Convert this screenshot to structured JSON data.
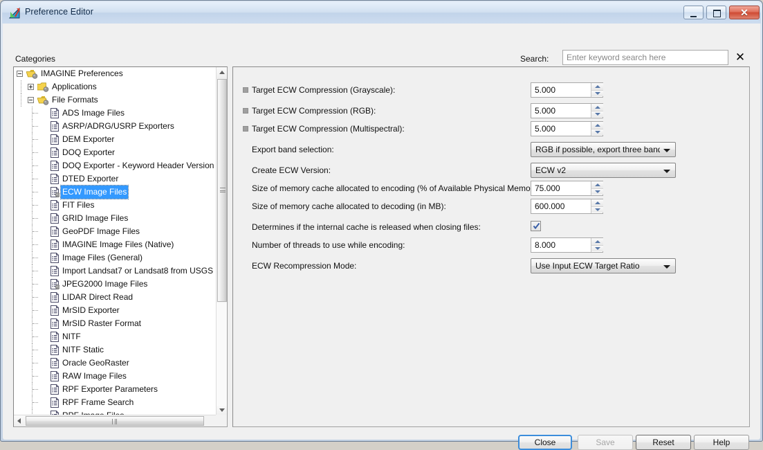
{
  "window": {
    "title": "Preference Editor",
    "icon": "imagine-app-icon",
    "controls": {
      "minimize": "minimize-icon",
      "maximize": "maximize-icon",
      "close": "✕"
    }
  },
  "header": {
    "categories_label": "Categories",
    "search_label": "Search:",
    "search_value": "",
    "search_placeholder": "Enter keyword search here",
    "search_clear_icon": "✕"
  },
  "tree": {
    "items": [
      {
        "label": "IMAGINE Preferences",
        "depth": 0,
        "icon": "folder-open-icon",
        "toggle": "minus",
        "selected": false
      },
      {
        "label": "Applications",
        "depth": 1,
        "icon": "folder-closed-icon",
        "toggle": "plus",
        "selected": false
      },
      {
        "label": "File Formats",
        "depth": 1,
        "icon": "folder-open-icon",
        "toggle": "minus",
        "selected": false
      },
      {
        "label": "ADS Image Files",
        "depth": 2,
        "icon": "document-icon",
        "toggle": "none",
        "selected": false
      },
      {
        "label": "ASRP/ADRG/USRP Exporters",
        "depth": 2,
        "icon": "document-icon",
        "toggle": "none",
        "selected": false
      },
      {
        "label": "DEM Exporter",
        "depth": 2,
        "icon": "document-icon",
        "toggle": "none",
        "selected": false
      },
      {
        "label": "DOQ Exporter",
        "depth": 2,
        "icon": "document-icon",
        "toggle": "none",
        "selected": false
      },
      {
        "label": "DOQ Exporter - Keyword Header Version",
        "depth": 2,
        "icon": "document-icon",
        "toggle": "none",
        "selected": false
      },
      {
        "label": "DTED Exporter",
        "depth": 2,
        "icon": "document-icon",
        "toggle": "none",
        "selected": false
      },
      {
        "label": "ECW Image Files",
        "depth": 2,
        "icon": "document-badge-icon",
        "toggle": "none",
        "selected": true
      },
      {
        "label": "FIT Files",
        "depth": 2,
        "icon": "document-icon",
        "toggle": "none",
        "selected": false
      },
      {
        "label": "GRID Image Files",
        "depth": 2,
        "icon": "document-icon",
        "toggle": "none",
        "selected": false
      },
      {
        "label": "GeoPDF Image Files",
        "depth": 2,
        "icon": "document-icon",
        "toggle": "none",
        "selected": false
      },
      {
        "label": "IMAGINE Image Files (Native)",
        "depth": 2,
        "icon": "document-icon",
        "toggle": "none",
        "selected": false
      },
      {
        "label": "Image Files (General)",
        "depth": 2,
        "icon": "document-icon",
        "toggle": "none",
        "selected": false
      },
      {
        "label": "Import Landsat7 or Landsat8 from USGS",
        "depth": 2,
        "icon": "document-icon",
        "toggle": "none",
        "selected": false
      },
      {
        "label": "JPEG2000 Image Files",
        "depth": 2,
        "icon": "document-badge-icon",
        "toggle": "none",
        "selected": false
      },
      {
        "label": "LIDAR Direct Read",
        "depth": 2,
        "icon": "document-icon",
        "toggle": "none",
        "selected": false
      },
      {
        "label": "MrSID Exporter",
        "depth": 2,
        "icon": "document-icon",
        "toggle": "none",
        "selected": false
      },
      {
        "label": "MrSID Raster Format",
        "depth": 2,
        "icon": "document-icon",
        "toggle": "none",
        "selected": false
      },
      {
        "label": "NITF",
        "depth": 2,
        "icon": "document-icon",
        "toggle": "none",
        "selected": false
      },
      {
        "label": "NITF Static",
        "depth": 2,
        "icon": "document-icon",
        "toggle": "none",
        "selected": false
      },
      {
        "label": "Oracle GeoRaster",
        "depth": 2,
        "icon": "document-icon",
        "toggle": "none",
        "selected": false
      },
      {
        "label": "RAW Image Files",
        "depth": 2,
        "icon": "document-icon",
        "toggle": "none",
        "selected": false
      },
      {
        "label": "RPF Exporter Parameters",
        "depth": 2,
        "icon": "document-icon",
        "toggle": "none",
        "selected": false
      },
      {
        "label": "RPF Frame Search",
        "depth": 2,
        "icon": "document-icon",
        "toggle": "none",
        "selected": false
      },
      {
        "label": "RPF Image Files",
        "depth": 2,
        "icon": "document-icon",
        "toggle": "none",
        "selected": false
      }
    ]
  },
  "settings": {
    "rows": [
      {
        "label": "Target ECW Compression (Grayscale):",
        "marker": true,
        "control": "spinner",
        "value": "5.000"
      },
      {
        "label": "Target ECW Compression (RGB):",
        "marker": true,
        "control": "spinner",
        "value": "5.000"
      },
      {
        "label": "Target ECW Compression (Multispectral):",
        "marker": true,
        "control": "spinner",
        "value": "5.000"
      },
      {
        "label": "Export band selection:",
        "marker": false,
        "control": "dropdown",
        "value": "RGB if possible, export three bands onl"
      },
      {
        "label": "Create ECW Version:",
        "marker": false,
        "control": "dropdown",
        "value": "ECW v2"
      },
      {
        "label": "Size of memory cache allocated to encoding (% of Available Physical Memory):",
        "marker": false,
        "control": "spinner",
        "value": "75.000"
      },
      {
        "label": "Size of memory cache allocated to decoding (in MB):",
        "marker": false,
        "control": "spinner",
        "value": "600.000"
      },
      {
        "label": "Determines if the internal cache is released when closing files:",
        "marker": false,
        "control": "checkbox",
        "value": "checked"
      },
      {
        "label": "Number of threads to use while encoding:",
        "marker": false,
        "control": "spinner",
        "value": "8.000"
      },
      {
        "label": "ECW Recompression Mode:",
        "marker": false,
        "control": "dropdown",
        "value": "Use Input ECW Target Ratio"
      }
    ]
  },
  "footer": {
    "close_label": "Close",
    "save_label": "Save",
    "reset_label": "Reset",
    "help_label": "Help"
  },
  "colors": {
    "selection_blue": "#3399ff",
    "focus_blue": "#3c8ddb",
    "close_red": "#cf4a33",
    "folder_yellow": "#f2d34a",
    "panel_gray": "#f0f0f0"
  }
}
